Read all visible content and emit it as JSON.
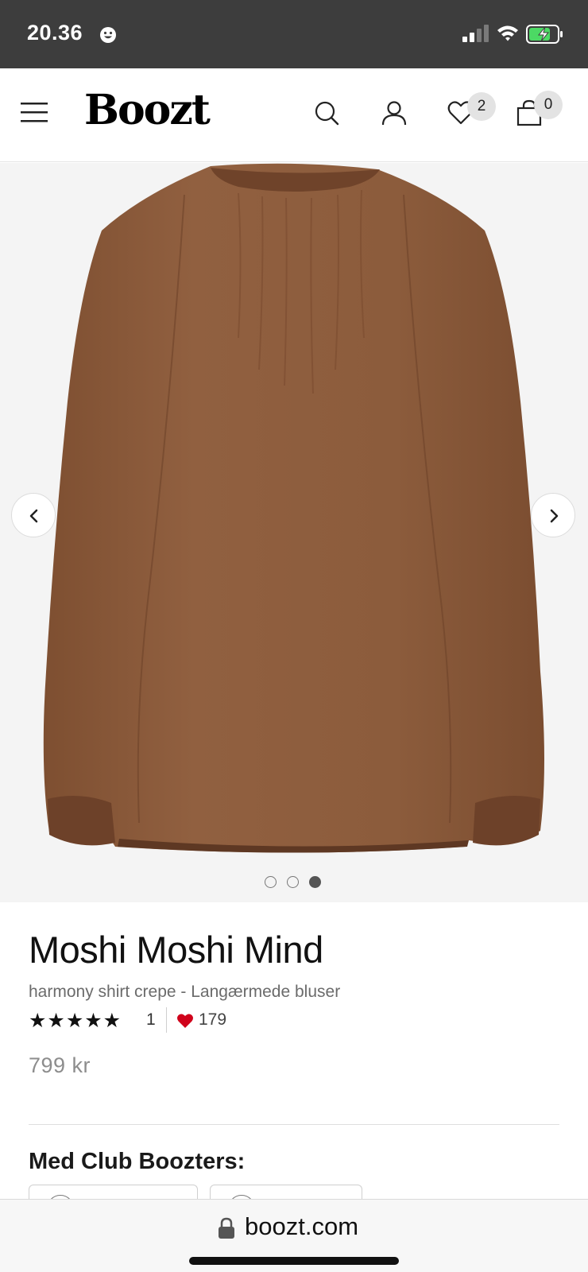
{
  "status_bar": {
    "time": "20.36",
    "bg_color": "#3d3d3d",
    "battery_color": "#4cd964"
  },
  "header": {
    "logo": "Boozt",
    "wishlist_count": "2",
    "cart_count": "0"
  },
  "gallery": {
    "image_description": "brown long-sleeve shirt crepe, back view",
    "image_color": "#8b5a3a",
    "slide_count": 3,
    "active_slide": 3
  },
  "product": {
    "brand": "Moshi Moshi Mind",
    "subtitle": "harmony shirt crepe - Langærmede bluser",
    "stars": "★★★★★",
    "rating_count": "1",
    "likes": "179",
    "heart_color": "#d0021b",
    "price": "799 kr"
  },
  "club": {
    "heading": "Med Club Boozters:"
  },
  "browser": {
    "url": "boozt.com"
  }
}
